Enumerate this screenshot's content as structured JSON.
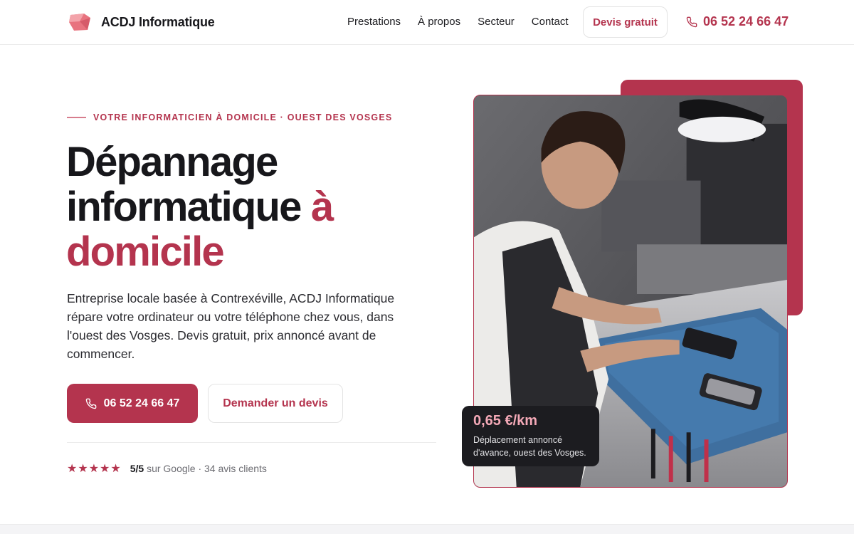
{
  "brand": {
    "name": "ACDJ Informatique",
    "color": "#b4344e"
  },
  "nav": {
    "items": [
      "Prestations",
      "À propos",
      "Secteur",
      "Contact"
    ],
    "quote_label": "Devis gratuit",
    "phone": "06 52 24 66 47"
  },
  "hero": {
    "eyebrow": "VOTRE INFORMATICIEN À DOMICILE · OUEST DES VOSGES",
    "headline_1": "Dépannage",
    "headline_2": "informatique",
    "headline_accent_1": "à",
    "headline_accent_2": "domicile",
    "description": "Entreprise locale basée à Contrexéville, ACDJ Informatique répare votre ordinateur ou votre téléphone chez vous, dans l'ouest des Vosges. Devis gratuit, prix annoncé avant de commencer.",
    "cta_phone": "06 52 24 66 47",
    "cta_quote": "Demander un devis",
    "rating": {
      "stars": "★★★★★",
      "score": "5/5",
      "text": "sur Google · 34 avis clients",
      "value": 5,
      "max": 5
    }
  },
  "price_card": {
    "value": "0,65 €/km",
    "note": "Déplacement annoncé d'avance, ouest des Vosges."
  },
  "icons": {
    "logo": "logo-mark-icon",
    "phone": "phone-icon"
  }
}
